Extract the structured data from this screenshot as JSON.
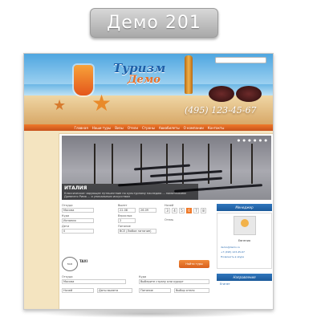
{
  "demo_label": "Демо 201",
  "site": {
    "logo_line1": "Туризм",
    "logo_line2": "Демо",
    "phone": "(495) 123-45-67",
    "search_placeholder": ""
  },
  "nav": [
    "Главная",
    "Наши туры",
    "Визы",
    "Отели",
    "Страны",
    "Авиабилеты",
    "О компании",
    "Контакты"
  ],
  "slider": {
    "title": "ИТАЛИЯ",
    "description": "Классическое чарующее путешествие по культурному наследию ... памятниками Древнего Рима ... и уникальным искусством",
    "pager": "● ● ● ● ● ●"
  },
  "search_form": {
    "from_label": "Откуда",
    "from_value": "Москва",
    "to_label": "Куда",
    "to_value": "Испания",
    "departure_label": "Вылет",
    "date_from": "22.08",
    "date_to": "26.09",
    "nights_label": "Ночей",
    "nights": [
      "3",
      "4",
      "5",
      "6",
      "7",
      "8"
    ],
    "adults_label": "Взрослых",
    "adults_value": "2",
    "meal_label": "Питание",
    "meal_value": "ВСЕ (Любое питание)",
    "children_label": "Дети",
    "children_value": "0",
    "stars_label": "Отель"
  },
  "taxi": {
    "logo": "TAXI",
    "name": "TAXI",
    "subtitle": "",
    "button": "Найти туры"
  },
  "sidebar": {
    "manager_header": "Менеджер",
    "manager_name": "Евгения",
    "manager_email": "demo@demo.ru",
    "manager_phone": "+7 (495) 123-45-67",
    "manager_skype": "Позвонить в skype",
    "directions_header": "Направления",
    "directions_item": "Египет"
  },
  "bottom_form": {
    "from_label": "Откуда",
    "from_value": "Москва",
    "to_label": "Куда",
    "to_value": "Выберите страну или курорт",
    "nights_label": "Ночей",
    "dates_label": "Даты вылета",
    "meal_label": "Питание",
    "hotels_label": "Выбор отеля"
  },
  "colors": {
    "accent": "#ef7a2a",
    "nav": "#d9601e",
    "sidebar_header": "#2a6bb0",
    "page_bg": "#f4e4c0"
  }
}
